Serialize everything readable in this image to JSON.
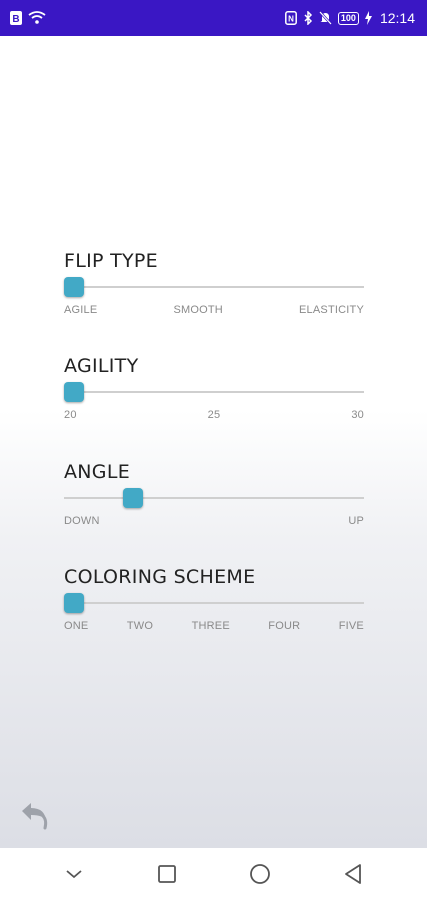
{
  "status_bar": {
    "time": "12:14",
    "battery": "100",
    "icons": [
      "notification-b-icon",
      "wifi-icon",
      "nfc-icon",
      "bluetooth-icon",
      "mute-icon",
      "battery-icon",
      "charging-icon"
    ]
  },
  "settings": [
    {
      "title": "FLIP TYPE",
      "labels": [
        "AGILE",
        "SMOOTH",
        "ELASTICITY"
      ],
      "value_fraction": 0.0
    },
    {
      "title": "AGILITY",
      "labels": [
        "20",
        "25",
        "30"
      ],
      "value_fraction": 0.0
    },
    {
      "title": "ANGLE",
      "labels": [
        "DOWN",
        "UP"
      ],
      "value_fraction": 0.21
    },
    {
      "title": "COLORING SCHEME",
      "labels": [
        "ONE",
        "TWO",
        "THREE",
        "FOUR",
        "FIVE"
      ],
      "value_fraction": 0.0
    }
  ],
  "colors": {
    "status_bar": "#3a17c4",
    "thumb": "#42a9c6",
    "track": "#cfcfcf"
  },
  "nav_bar": {
    "icons": [
      "chevron-down-icon",
      "recents-square-icon",
      "home-circle-icon",
      "back-triangle-icon"
    ]
  }
}
